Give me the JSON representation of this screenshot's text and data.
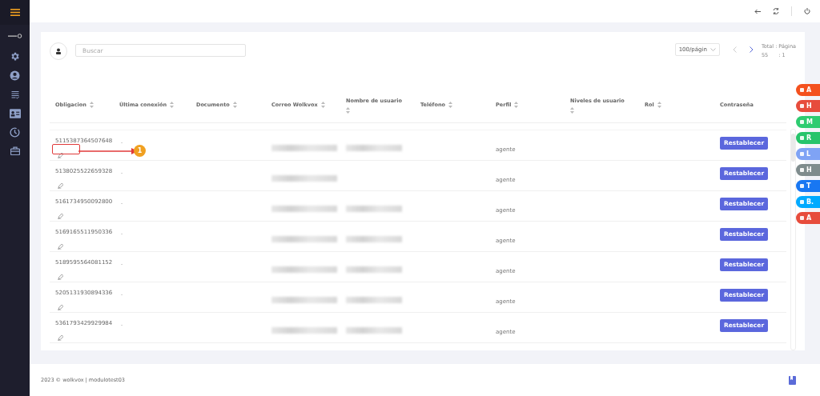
{
  "search": {
    "placeholder": "Buscar"
  },
  "pagination": {
    "page_size": "100/págin",
    "total_label": "Total :",
    "total": "55",
    "page_label": "Página",
    "page": ": 1"
  },
  "table": {
    "columns": [
      {
        "label": "Obligacion",
        "sortable": true
      },
      {
        "label": "Última conexión",
        "sortable": true
      },
      {
        "label": "Documento",
        "sortable": true
      },
      {
        "label": "Correo Wolkvox",
        "sortable": true
      },
      {
        "label": "Nombre de usuario",
        "sortable": true
      },
      {
        "label": "Teléfono",
        "sortable": true
      },
      {
        "label": "Perfil",
        "sortable": true
      },
      {
        "label": "Niveles de usuario",
        "sortable": true
      },
      {
        "label": "Rol",
        "sortable": true
      },
      {
        "label": "Contraseña",
        "sortable": false
      }
    ],
    "rows": [
      {
        "obligacion": "5115387364507648",
        "ultima_conexion": "-",
        "username_shown": true,
        "perfil": "agente",
        "action": "Restablecer",
        "highlighted": true
      },
      {
        "obligacion": "5138025522659328",
        "ultima_conexion": "-",
        "username_shown": false,
        "perfil": "agente",
        "action": "Restablecer",
        "highlighted": false
      },
      {
        "obligacion": "5161734950092800",
        "ultima_conexion": "-",
        "username_shown": true,
        "perfil": "agente",
        "action": "Restablecer",
        "highlighted": false
      },
      {
        "obligacion": "5169165511950336",
        "ultima_conexion": "-",
        "username_shown": true,
        "perfil": "agente",
        "action": "Restablecer",
        "highlighted": false
      },
      {
        "obligacion": "5189595564081152",
        "ultima_conexion": "-",
        "username_shown": true,
        "perfil": "agente",
        "action": "Restablecer",
        "highlighted": false
      },
      {
        "obligacion": "5205131930894336",
        "ultima_conexion": "-",
        "username_shown": true,
        "perfil": "agente",
        "action": "Restablecer",
        "highlighted": false
      },
      {
        "obligacion": "5361793429929984",
        "ultima_conexion": "-",
        "username_shown": true,
        "perfil": "agente",
        "action": "Restablecer",
        "highlighted": false
      }
    ]
  },
  "annotation": {
    "number": "1"
  },
  "side_actions": [
    {
      "label": "A",
      "color": "#f4511e"
    },
    {
      "label": "H",
      "color": "#e74c3c"
    },
    {
      "label": "M",
      "color": "#2ecc71"
    },
    {
      "label": "R",
      "color": "#27c46b"
    },
    {
      "label": "L",
      "color": "#7fa3f5"
    },
    {
      "label": "H",
      "color": "#7f8c8d"
    },
    {
      "label": "T",
      "color": "#1877f2"
    },
    {
      "label": "B.",
      "color": "#00aaff"
    },
    {
      "label": "A",
      "color": "#e74c3c"
    }
  ],
  "footer": {
    "text": "2023 © wolkvox | modulotest03"
  }
}
